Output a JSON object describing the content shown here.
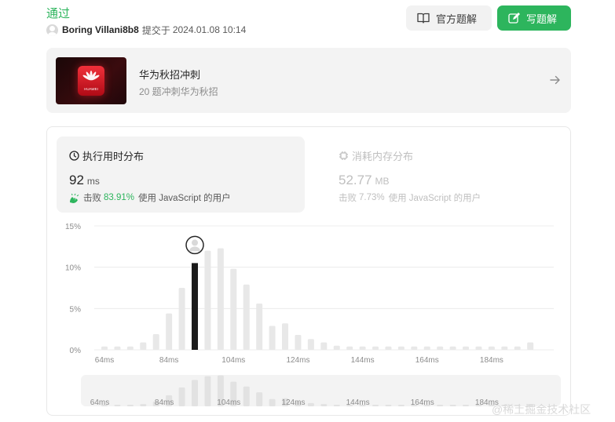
{
  "submission": {
    "status": "通过",
    "user": "Boring Villani8b8",
    "submitted_prefix": "提交于",
    "submitted_time": "2024.01.08 10:14"
  },
  "buttons": {
    "official_solution": "官方题解",
    "write_solution": "写题解"
  },
  "banner": {
    "title": "华为秋招冲刺",
    "subtitle": "20 题冲刺华为秋招",
    "logo_text": "HUAWEI"
  },
  "runtime_card": {
    "title": "执行用时分布",
    "value": "92",
    "unit": "ms",
    "beat_prefix": "击败",
    "beat_pct": "83.91%",
    "beat_suffix": "使用 JavaScript 的用户"
  },
  "memory_card": {
    "title": "消耗内存分布",
    "value": "52.77",
    "unit": "MB",
    "beat_prefix": "击败",
    "beat_pct": "7.73%",
    "beat_suffix": "使用 JavaScript 的用户"
  },
  "chart_data": {
    "type": "bar",
    "title": "",
    "xlabel": "",
    "ylabel": "",
    "ylim": [
      0,
      15
    ],
    "y_ticks": [
      "15%",
      "10%",
      "5%",
      "0%"
    ],
    "x_ticks": [
      "64ms",
      "84ms",
      "104ms",
      "124ms",
      "144ms",
      "164ms",
      "184ms"
    ],
    "x": [
      64,
      68,
      72,
      76,
      80,
      84,
      88,
      92,
      96,
      100,
      104,
      108,
      112,
      116,
      120,
      124,
      128,
      132,
      136,
      140,
      144,
      148,
      152,
      156,
      160,
      164,
      168,
      172,
      176,
      180,
      184,
      188,
      192,
      196
    ],
    "values": [
      0.4,
      0.4,
      0.4,
      0.9,
      1.9,
      4.4,
      7.5,
      10.5,
      12.0,
      12.3,
      9.8,
      7.9,
      5.6,
      2.9,
      3.2,
      1.8,
      1.3,
      0.9,
      0.5,
      0.4,
      0.4,
      0.4,
      0.4,
      0.4,
      0.4,
      0.4,
      0.4,
      0.4,
      0.4,
      0.4,
      0.4,
      0.4,
      0.4,
      0.9
    ],
    "highlight_x": 92,
    "grid": true,
    "colors": {
      "bar": "#e8e8e8",
      "highlight": "#1a1a1a",
      "grid": "#ececec"
    }
  },
  "watermark": "@稀土掘金技术社区"
}
